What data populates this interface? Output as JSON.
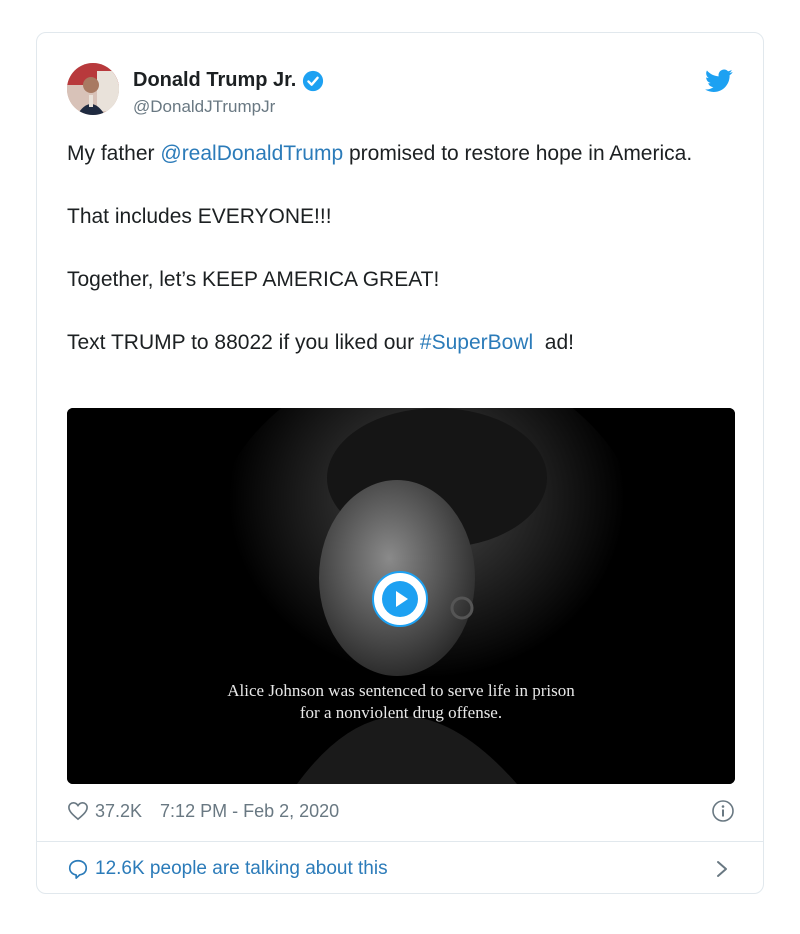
{
  "tweet": {
    "author": {
      "display_name": "Donald Trump Jr.",
      "handle": "@DonaldJTrumpJr",
      "verified": true
    },
    "paragraphs": [
      {
        "pre": "My father ",
        "mention": "@realDonaldTrump",
        "post": " promised to restore hope in America."
      },
      {
        "text": "That includes EVERYONE!!!"
      },
      {
        "text": "Together, let’s KEEP AMERICA GREAT!"
      },
      {
        "pre": "Text TRUMP to 88022 if you liked our ",
        "hashtag": "#SuperBowl",
        "post": "  ad!"
      }
    ],
    "media": {
      "caption_line1": "Alice Johnson was sentenced to serve life in prison",
      "caption_line2": "for a nonviolent drug offense."
    },
    "likes": "37.2K",
    "timestamp": "7:12 PM - Feb 2, 2020",
    "talking": "12.6K people are talking about this"
  },
  "colors": {
    "link": "#2b7bb9",
    "twitter_blue": "#1da1f2",
    "muted": "#697882"
  },
  "icons": [
    "verified-icon",
    "twitter-bird-icon",
    "play-icon",
    "heart-icon",
    "info-icon",
    "speech-bubble-icon",
    "chevron-right-icon"
  ]
}
